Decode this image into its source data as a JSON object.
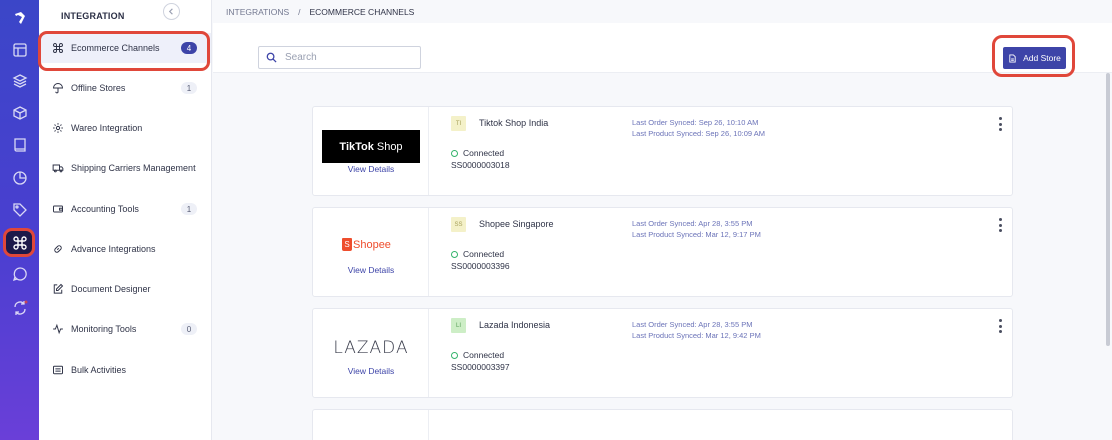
{
  "rail": {
    "icons": [
      "logo-icon",
      "layout-icon",
      "layers-icon",
      "box-icon",
      "book-icon",
      "chart-pie-icon",
      "tag-icon",
      "command-icon",
      "chat-icon",
      "sync-icon"
    ],
    "active": "command-icon"
  },
  "sidebar": {
    "title": "INTEGRATION",
    "items": [
      {
        "label": "Ecommerce Channels",
        "badge": "4",
        "icon": "command-icon",
        "active": true
      },
      {
        "label": "Offline Stores",
        "badge": "1",
        "icon": "umbrella-icon"
      },
      {
        "label": "Wareo Integration",
        "badge": "",
        "icon": "settings-icon"
      },
      {
        "label": "Shipping Carriers Management",
        "badge": "",
        "icon": "truck-icon"
      },
      {
        "label": "Accounting Tools",
        "badge": "1",
        "icon": "wallet-icon"
      },
      {
        "label": "Advance Integrations",
        "badge": "",
        "icon": "link-icon"
      },
      {
        "label": "Document Designer",
        "badge": "",
        "icon": "edit-icon"
      },
      {
        "label": "Monitoring Tools",
        "badge": "0",
        "icon": "activity-icon"
      },
      {
        "label": "Bulk Activities",
        "badge": "",
        "icon": "list-icon"
      }
    ]
  },
  "breadcrumb": {
    "parent": "INTEGRATIONS",
    "separator": "/",
    "current": "ECOMMERCE CHANNELS"
  },
  "search": {
    "placeholder": "Search",
    "value": ""
  },
  "add_store": {
    "label": "Add Store"
  },
  "stores": [
    {
      "logo_text": "TikTok",
      "logo_sub": "Shop",
      "view_label": "View Details",
      "avatar": "TI",
      "name": "Tiktok Shop India",
      "status": "Connected",
      "store_id": "SS0000003018",
      "last_order": "Last Order Synced: Sep 26, 10:10 AM",
      "last_product": "Last Product Synced: Sep 26, 10:09 AM"
    },
    {
      "logo_text": "Shopee",
      "view_label": "View Details",
      "avatar": "SS",
      "name": "Shopee Singapore",
      "status": "Connected",
      "store_id": "SS0000003396",
      "last_order": "Last Order Synced: Apr 28, 3:55 PM",
      "last_product": "Last Product Synced: Mar 12, 9:17 PM"
    },
    {
      "logo_text": "LAZADA",
      "view_label": "View Details",
      "avatar": "LI",
      "name": "Lazada Indonesia",
      "status": "Connected",
      "store_id": "SS0000003397",
      "last_order": "Last Order Synced: Apr 28, 3:55 PM",
      "last_product": "Last Product Synced: Mar 12, 9:42 PM"
    }
  ],
  "colors": {
    "accent": "#3d44a8",
    "highlight": "#e0473a",
    "connected": "#34b36b"
  }
}
